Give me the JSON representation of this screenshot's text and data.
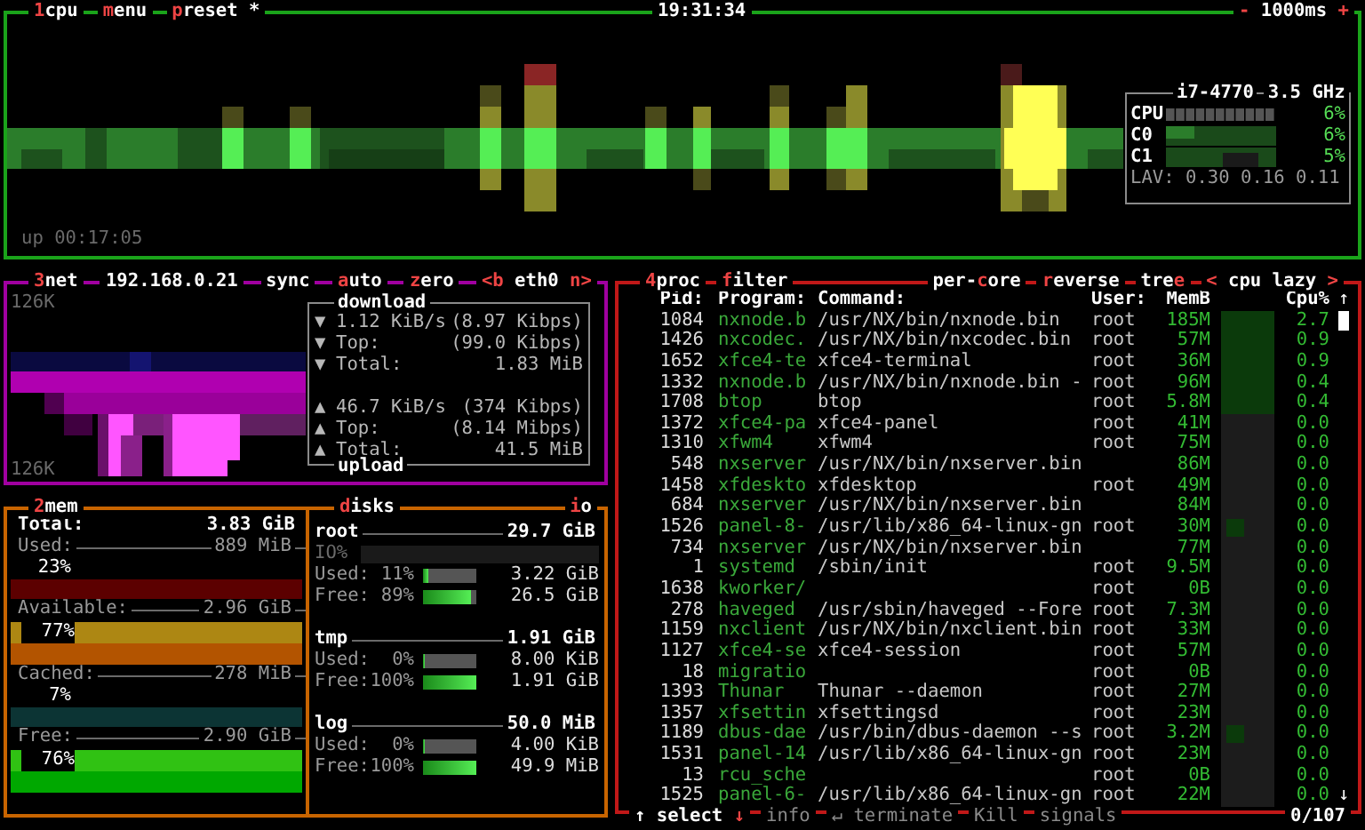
{
  "cpu": {
    "title_items": [
      {
        "parts": [
          {
            "text": "1",
            "hot": true
          },
          {
            "text": "cpu",
            "hot": false
          }
        ]
      },
      {
        "parts": [
          {
            "text": "m",
            "hot": true
          },
          {
            "text": "enu",
            "hot": false
          }
        ]
      },
      {
        "parts": [
          {
            "text": "p",
            "hot": true
          },
          {
            "text": "reset *",
            "hot": false
          }
        ]
      }
    ],
    "clock": "19:31:34",
    "rate": {
      "parts": [
        {
          "text": "-",
          "hot": true
        },
        {
          "text": " 1000ms ",
          "hot": false
        },
        {
          "text": "+",
          "hot": true
        }
      ]
    },
    "info": {
      "model": "i7-4770",
      "frequency": "3.5 GHz",
      "rows": [
        {
          "label": "CPU",
          "value": "6%",
          "kind": "meter"
        },
        {
          "label": "C0",
          "value": "6%",
          "kind": "graph"
        },
        {
          "label": "C1",
          "value": "5%",
          "kind": "graph"
        }
      ],
      "load": "LAV: 0.30 0.16 0.11"
    },
    "uptime": "up 00:17:05"
  },
  "net": {
    "title_items": [
      {
        "parts": [
          {
            "text": "3",
            "hot": true
          },
          {
            "text": "net",
            "hot": false
          }
        ]
      },
      {
        "parts": [
          {
            "text": "192.168.0.21",
            "hot": false
          }
        ]
      },
      {
        "parts": [
          {
            "text": "sync",
            "hot": false
          }
        ]
      },
      {
        "parts": [
          {
            "text": "a",
            "hot": true
          },
          {
            "text": "uto",
            "hot": false
          }
        ]
      },
      {
        "parts": [
          {
            "text": "z",
            "hot": true
          },
          {
            "text": "ero",
            "hot": false
          }
        ]
      },
      {
        "parts": [
          {
            "text": "<b",
            "hot": true
          },
          {
            "text": " eth0 ",
            "hot": false
          },
          {
            "text": "n>",
            "hot": true
          }
        ]
      }
    ],
    "scale_top": "126K",
    "scale_bottom": "126K",
    "download": {
      "title": "download",
      "rows": [
        {
          "arrow": "▼",
          "label": "1.12 KiB/s",
          "value": "(8.97 Kibps)"
        },
        {
          "arrow": "▼",
          "label": "Top:",
          "value": "(99.0 Kibps)"
        },
        {
          "arrow": "▼",
          "label": "Total:",
          "value": "1.83 MiB"
        }
      ]
    },
    "upload": {
      "title": "upload",
      "rows": [
        {
          "arrow": "▲",
          "label": "46.7 KiB/s",
          "value": "(374 Kibps)"
        },
        {
          "arrow": "▲",
          "label": "Top:",
          "value": "(8.14 Mibps)"
        },
        {
          "arrow": "▲",
          "label": "Total:",
          "value": "41.5 MiB"
        }
      ]
    }
  },
  "mem": {
    "title_items": [
      {
        "parts": [
          {
            "text": "2",
            "hot": true
          },
          {
            "text": "mem",
            "hot": false
          }
        ]
      }
    ],
    "total_label": "Total:",
    "total": "3.83 GiB",
    "items": [
      {
        "label": "Used:",
        "value": "889 MiB",
        "percent": "23%",
        "kind": "single",
        "color": "#5c0000"
      },
      {
        "label": "Available:",
        "value": "2.96 GiB",
        "percent": "77%",
        "kind": "double",
        "color": "#b35400"
      },
      {
        "label": "Cached:",
        "value": "278 MiB",
        "percent": "7%",
        "kind": "single",
        "color": "#0c3434"
      },
      {
        "label": "Free:",
        "value": "2.90 GiB",
        "percent": "76%",
        "kind": "double",
        "color": "#00a800"
      }
    ]
  },
  "disks": {
    "title_items": [
      {
        "parts": [
          {
            "text": "d",
            "hot": true
          },
          {
            "text": "isks",
            "hot": false
          }
        ]
      }
    ],
    "io_item": {
      "parts": [
        {
          "text": "i",
          "hot": true
        },
        {
          "text": "o",
          "hot": false
        }
      ]
    },
    "items": [
      {
        "name": "root",
        "size": "29.7 GiB",
        "io_label": "IO%",
        "rows": [
          {
            "label": "Used:",
            "percent": "11%",
            "level": 0.11,
            "value": "3.22 GiB"
          },
          {
            "label": "Free:",
            "percent": "89%",
            "level": 0.89,
            "value": "26.5 GiB"
          }
        ]
      },
      {
        "name": "tmp",
        "size": "1.91 GiB",
        "rows": [
          {
            "label": "Used:",
            "percent": "0%",
            "level": 0,
            "value": "8.00 KiB"
          },
          {
            "label": "Free:",
            "percent": "100%",
            "level": 1,
            "value": "1.91 GiB"
          }
        ]
      },
      {
        "name": "log",
        "size": "50.0 MiB",
        "rows": [
          {
            "label": "Used:",
            "percent": "0%",
            "level": 0,
            "value": "4.00 KiB"
          },
          {
            "label": "Free:",
            "percent": "100%",
            "level": 1,
            "value": "49.9 MiB"
          }
        ]
      }
    ]
  },
  "proc": {
    "title_left": [
      {
        "parts": [
          {
            "text": "4",
            "hot": true
          },
          {
            "text": "proc",
            "hot": false
          }
        ]
      },
      {
        "parts": [
          {
            "text": "f",
            "hot": true
          },
          {
            "text": "ilter",
            "hot": false
          }
        ]
      }
    ],
    "title_right": [
      {
        "parts": [
          {
            "text": "per-",
            "hot": false
          },
          {
            "text": "c",
            "hot": true
          },
          {
            "text": "ore",
            "hot": false
          }
        ]
      },
      {
        "parts": [
          {
            "text": "r",
            "hot": true
          },
          {
            "text": "everse",
            "hot": false
          }
        ]
      },
      {
        "parts": [
          {
            "text": "tre",
            "hot": false
          },
          {
            "text": "e",
            "hot": true
          }
        ]
      },
      {
        "parts": [
          {
            "text": "<",
            "hot": true
          },
          {
            "text": " cpu lazy ",
            "hot": false
          },
          {
            "text": ">",
            "hot": true
          }
        ]
      }
    ],
    "columns": [
      "Pid:",
      "Program:",
      "Command:",
      "User:",
      "MemB",
      "Cpu%"
    ],
    "scroll_up": "↑",
    "scroll_down": "↓",
    "rows": [
      {
        "pid": "1084",
        "program": "nxnode.b",
        "command": "/usr/NX/bin/nxnode.bin",
        "user": "root",
        "mem": "185M",
        "cpu": "2.7",
        "kind": "full"
      },
      {
        "pid": "1426",
        "program": "nxcodec.",
        "command": "/usr/NX/bin/nxcodec.bin",
        "user": "root",
        "mem": "57M",
        "cpu": "0.9",
        "kind": "full"
      },
      {
        "pid": "1652",
        "program": "xfce4-te",
        "command": "xfce4-terminal",
        "user": "root",
        "mem": "36M",
        "cpu": "0.9",
        "kind": "full"
      },
      {
        "pid": "1332",
        "program": "nxnode.b",
        "command": "/usr/NX/bin/nxnode.bin -",
        "user": "root",
        "mem": "96M",
        "cpu": "0.4",
        "kind": "full"
      },
      {
        "pid": "1708",
        "program": "btop",
        "command": "btop",
        "user": "root",
        "mem": "5.8M",
        "cpu": "0.4",
        "kind": "full"
      },
      {
        "pid": "1372",
        "program": "xfce4-pa",
        "command": "xfce4-panel",
        "user": "root",
        "mem": "41M",
        "cpu": "0.0",
        "kind": "none"
      },
      {
        "pid": "1310",
        "program": "xfwm4",
        "command": "xfwm4",
        "user": "root",
        "mem": "75M",
        "cpu": "0.0",
        "kind": "none"
      },
      {
        "pid": "548",
        "program": "nxserver",
        "command": "/usr/NX/bin/nxserver.bin",
        "mem": "86M",
        "cpu": "0.0",
        "kind": "none"
      },
      {
        "pid": "1458",
        "program": "xfdeskto",
        "command": "xfdesktop",
        "user": "root",
        "mem": "49M",
        "cpu": "0.0",
        "kind": "none"
      },
      {
        "pid": "684",
        "program": "nxserver",
        "command": "/usr/NX/bin/nxserver.bin",
        "mem": "84M",
        "cpu": "0.0",
        "kind": "none"
      },
      {
        "pid": "1526",
        "program": "panel-8-",
        "command": "/usr/lib/x86_64-linux-gn",
        "user": "root",
        "mem": "30M",
        "cpu": "0.0",
        "kind": "dot"
      },
      {
        "pid": "734",
        "program": "nxserver",
        "command": "/usr/NX/bin/nxserver.bin",
        "mem": "77M",
        "cpu": "0.0",
        "kind": "none"
      },
      {
        "pid": "1",
        "program": "systemd",
        "command": "/sbin/init",
        "user": "root",
        "mem": "9.5M",
        "cpu": "0.0",
        "kind": "none"
      },
      {
        "pid": "1638",
        "program": "kworker/",
        "user": "root",
        "mem": "0B",
        "cpu": "0.0",
        "kind": "none"
      },
      {
        "pid": "278",
        "program": "haveged",
        "command": "/usr/sbin/haveged --Fore",
        "user": "root",
        "mem": "7.3M",
        "cpu": "0.0",
        "kind": "none"
      },
      {
        "pid": "1159",
        "program": "nxclient",
        "command": "/usr/NX/bin/nxclient.bin",
        "user": "root",
        "mem": "33M",
        "cpu": "0.0",
        "kind": "none"
      },
      {
        "pid": "1127",
        "program": "xfce4-se",
        "command": "xfce4-session",
        "user": "root",
        "mem": "57M",
        "cpu": "0.0",
        "kind": "none"
      },
      {
        "pid": "18",
        "program": "migratio",
        "user": "root",
        "mem": "0B",
        "cpu": "0.0",
        "kind": "none"
      },
      {
        "pid": "1393",
        "program": "Thunar",
        "command": "Thunar --daemon",
        "user": "root",
        "mem": "27M",
        "cpu": "0.0",
        "kind": "none"
      },
      {
        "pid": "1357",
        "program": "xfsettin",
        "command": "xfsettingsd",
        "user": "root",
        "mem": "23M",
        "cpu": "0.0",
        "kind": "none"
      },
      {
        "pid": "1189",
        "program": "dbus-dae",
        "command": "/usr/bin/dbus-daemon --s",
        "user": "root",
        "mem": "3.2M",
        "cpu": "0.0",
        "kind": "dot"
      },
      {
        "pid": "1531",
        "program": "panel-14",
        "command": "/usr/lib/x86_64-linux-gn",
        "user": "root",
        "mem": "23M",
        "cpu": "0.0",
        "kind": "none"
      },
      {
        "pid": "13",
        "program": "rcu_sche",
        "user": "root",
        "mem": "0B",
        "cpu": "0.0",
        "kind": "none"
      },
      {
        "pid": "1525",
        "program": "panel-6-",
        "command": "/usr/lib/x86_64-linux-gn",
        "user": "root",
        "mem": "22M",
        "cpu": "0.0",
        "kind": "none"
      }
    ],
    "footer_items": [
      {
        "parts": [
          {
            "text": "↑",
            "hot": false
          },
          {
            "text": " select ",
            "hot": false
          },
          {
            "text": "↓",
            "hot": true
          }
        ],
        "disabled": false
      },
      {
        "parts": [
          {
            "text": "info",
            "hot": false
          }
        ],
        "disabled": true
      },
      {
        "parts": [
          {
            "text": "↵ terminate",
            "hot": false
          }
        ],
        "disabled": true
      },
      {
        "parts": [
          {
            "text": "Kill",
            "hot": false
          }
        ],
        "disabled": true
      },
      {
        "parts": [
          {
            "text": "signals",
            "hot": false
          }
        ],
        "disabled": true
      }
    ],
    "count": "0/107"
  }
}
